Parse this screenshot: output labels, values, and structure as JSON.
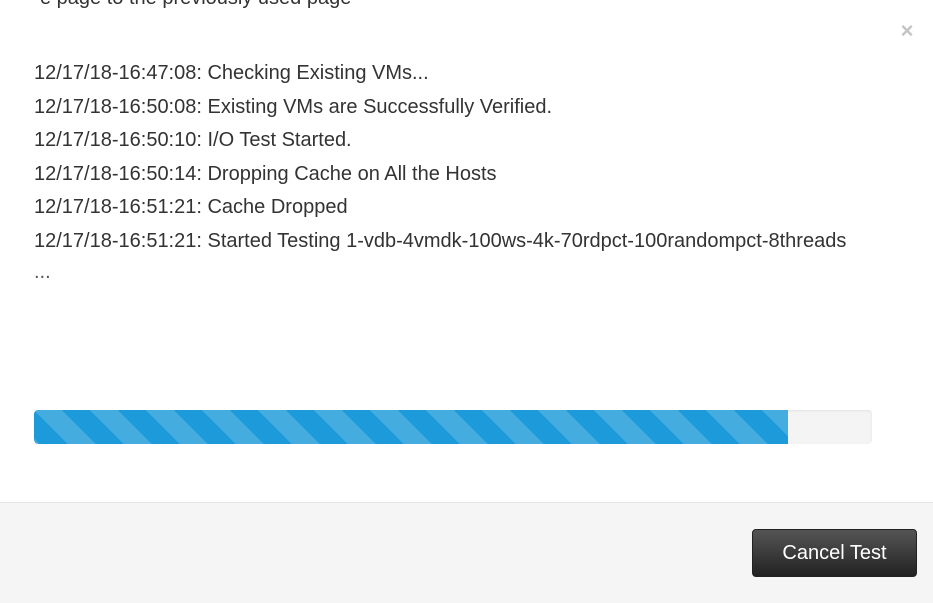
{
  "window": {
    "top_clipped_text": "e page to the previously used page"
  },
  "dialog": {
    "close_glyph": "×",
    "log_lines": [
      "12/17/18-16:47:08: Checking Existing VMs...",
      "12/17/18-16:50:08: Existing VMs are Successfully Verified.",
      "12/17/18-16:50:10: I/O Test Started.",
      "12/17/18-16:50:14: Dropping Cache on All the Hosts",
      "12/17/18-16:51:21: Cache Dropped",
      "12/17/18-16:51:21: Started Testing 1-vdb-4vmdk-100ws-4k-70rdpct-100randompct-8threads"
    ],
    "log_ellipsis": "...",
    "progress": {
      "fraction": 0.9,
      "color": "#1c9ad9"
    },
    "cancel_label": "Cancel Test"
  }
}
